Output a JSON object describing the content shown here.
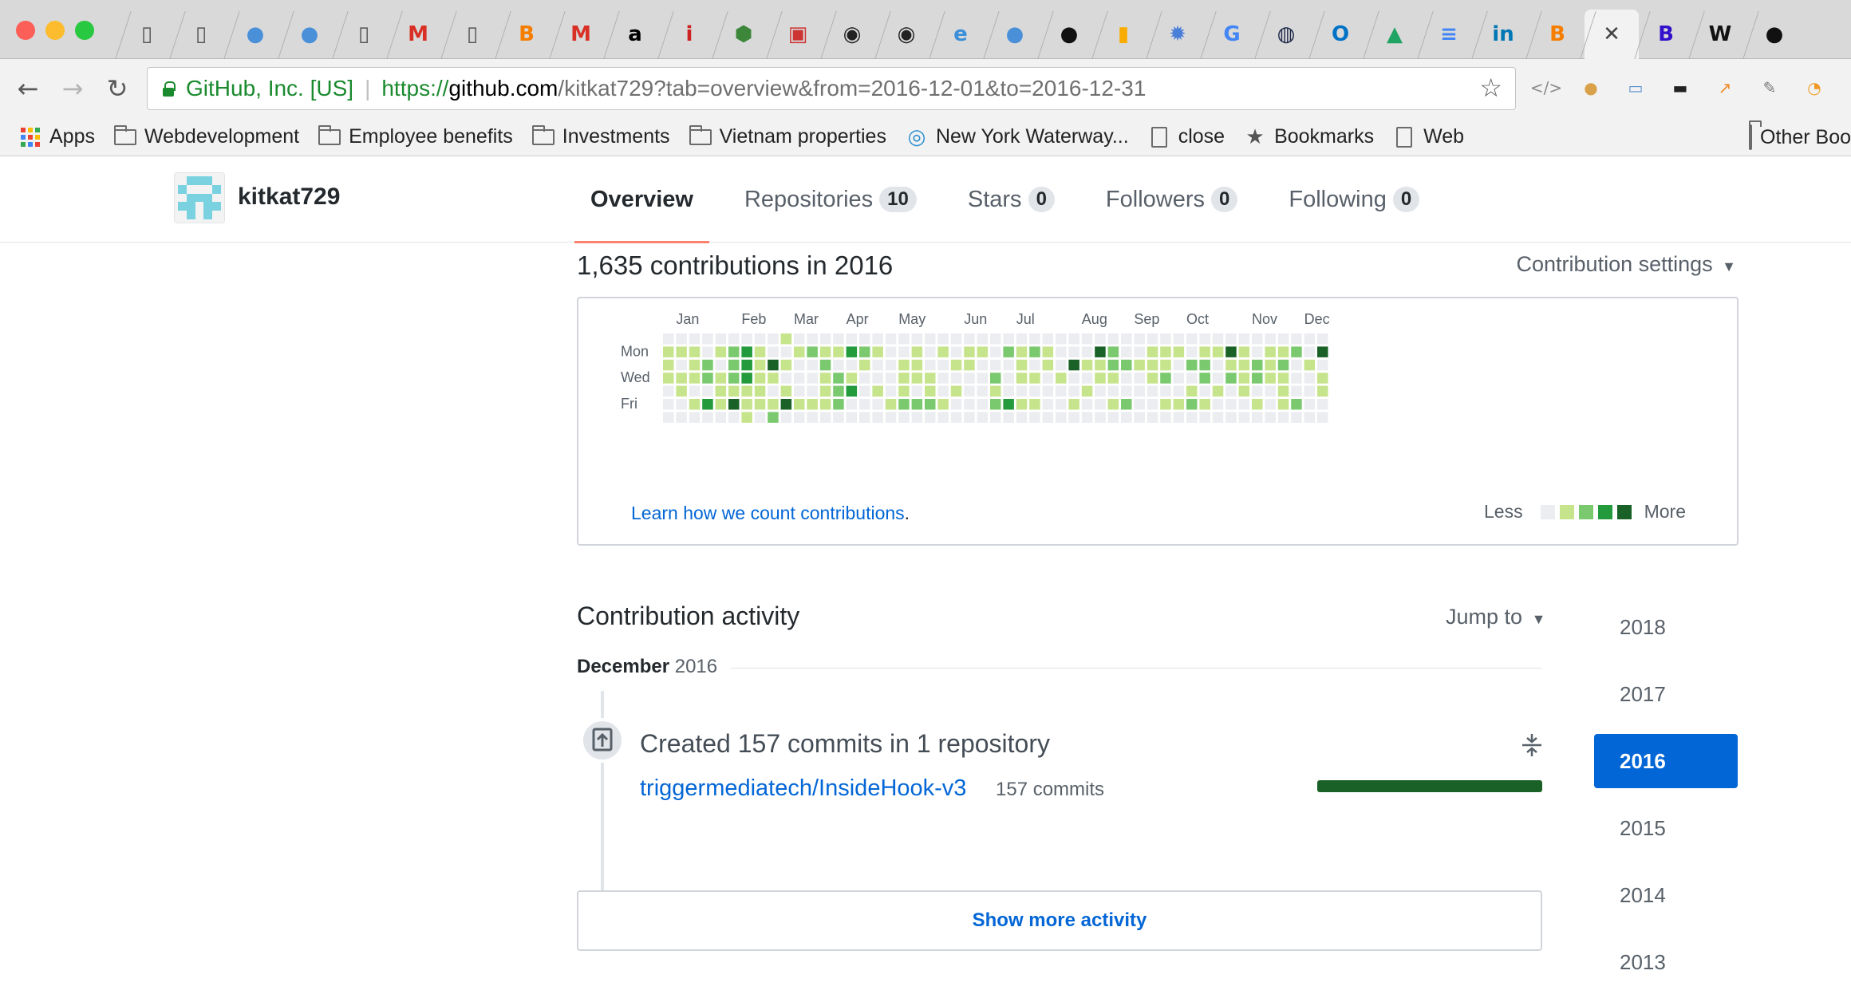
{
  "browser": {
    "tabs": [
      {
        "icon": "page-icon",
        "glyph": "▯",
        "color": "#555555"
      },
      {
        "icon": "page-icon",
        "glyph": "▯",
        "color": "#555555"
      },
      {
        "icon": "head-icon",
        "glyph": "●",
        "color": "#4a90d9"
      },
      {
        "icon": "head-icon",
        "glyph": "●",
        "color": "#4a90d9"
      },
      {
        "icon": "page-icon",
        "glyph": "▯",
        "color": "#555555"
      },
      {
        "icon": "gmail-icon",
        "glyph": "M",
        "color": "#d93025"
      },
      {
        "icon": "page-icon",
        "glyph": "▯",
        "color": "#555555"
      },
      {
        "icon": "blogger-icon",
        "glyph": "B",
        "color": "#f57d00"
      },
      {
        "icon": "gmail-icon",
        "glyph": "M",
        "color": "#d93025"
      },
      {
        "icon": "amazon-icon",
        "glyph": "a",
        "color": "#000000"
      },
      {
        "icon": "italic-i-icon",
        "glyph": "i",
        "color": "#cc2222"
      },
      {
        "icon": "node-icon",
        "glyph": "⬢",
        "color": "#3c873a"
      },
      {
        "icon": "briefcase-icon",
        "glyph": "▣",
        "color": "#cc3333"
      },
      {
        "icon": "seal-icon",
        "glyph": "◉",
        "color": "#222222"
      },
      {
        "icon": "seal-icon",
        "glyph": "◉",
        "color": "#222222"
      },
      {
        "icon": "ie-icon",
        "glyph": "e",
        "color": "#3a8fd9"
      },
      {
        "icon": "head-icon",
        "glyph": "●",
        "color": "#4a90d9"
      },
      {
        "icon": "github-icon",
        "glyph": "●",
        "color": "#111111"
      },
      {
        "icon": "analytics-icon",
        "glyph": "▮",
        "color": "#f9ab00"
      },
      {
        "icon": "gear-bug-icon",
        "glyph": "✹",
        "color": "#4a7fd9"
      },
      {
        "icon": "google-icon",
        "glyph": "G",
        "color": "#4285f4"
      },
      {
        "icon": "lightbulb-icon",
        "glyph": "◍",
        "color": "#1e2a4a"
      },
      {
        "icon": "outlook-icon",
        "glyph": "O",
        "color": "#0072c6"
      },
      {
        "icon": "drive-icon",
        "glyph": "▲",
        "color": "#1fa463"
      },
      {
        "icon": "docs-icon",
        "glyph": "≡",
        "color": "#4285f4"
      },
      {
        "icon": "linkedin-icon",
        "glyph": "in",
        "color": "#0077b5"
      },
      {
        "icon": "blogger-icon",
        "glyph": "B",
        "color": "#f57d00"
      },
      {
        "icon": "close-icon",
        "glyph": "✕",
        "color": "#444444",
        "active": true
      },
      {
        "icon": "bootstrap-icon",
        "glyph": "B",
        "color": "#3311cc"
      },
      {
        "icon": "wikipedia-icon",
        "glyph": "W",
        "color": "#111111"
      },
      {
        "icon": "github-icon",
        "glyph": "●",
        "color": "#111111"
      }
    ],
    "address": {
      "org": "GitHub, Inc. [US]",
      "scheme": "https://",
      "host": "github.com",
      "path": "/kitkat729?tab=overview&from=2016-12-01&to=2016-12-31"
    },
    "extensions": [
      {
        "icon": "code-icon",
        "glyph": "</>",
        "color": "#8a8a8a"
      },
      {
        "icon": "cookie-icon",
        "glyph": "●",
        "color": "#d9a24a"
      },
      {
        "icon": "window-icon",
        "glyph": "▭",
        "color": "#5b8fd0"
      },
      {
        "icon": "terminal-icon",
        "glyph": "▬",
        "color": "#222222"
      },
      {
        "icon": "chart-icon",
        "glyph": "↗",
        "color": "#f08a24"
      },
      {
        "icon": "pencil-icon",
        "glyph": "✎",
        "color": "#777777"
      },
      {
        "icon": "rss-icon",
        "glyph": "◔",
        "color": "#f09a24"
      }
    ],
    "bookmarks": [
      {
        "icon": "apps-icon",
        "label": "Apps"
      },
      {
        "icon": "folder-icon",
        "label": "Webdevelopment"
      },
      {
        "icon": "folder-icon",
        "label": "Employee benefits"
      },
      {
        "icon": "folder-icon",
        "label": "Investments"
      },
      {
        "icon": "folder-icon",
        "label": "Vietnam properties"
      },
      {
        "icon": "waterway-icon",
        "label": "New York Waterway..."
      },
      {
        "icon": "page-icon",
        "label": "close"
      },
      {
        "icon": "star-icon",
        "label": "Bookmarks"
      },
      {
        "icon": "page-icon",
        "label": "Web"
      }
    ],
    "other_bookmarks": "Other Boo"
  },
  "profile": {
    "username": "kitkat729",
    "avatar_color": "#7ad2e0",
    "nav": [
      {
        "label": "Overview",
        "active": true
      },
      {
        "label": "Repositories",
        "count": "10"
      },
      {
        "label": "Stars",
        "count": "0"
      },
      {
        "label": "Followers",
        "count": "0"
      },
      {
        "label": "Following",
        "count": "0"
      }
    ]
  },
  "contributions": {
    "title": "1,635 contributions in 2016",
    "settings_label": "Contribution settings",
    "months": [
      "Jan",
      "Feb",
      "Mar",
      "Apr",
      "May",
      "Jun",
      "Jul",
      "Aug",
      "Sep",
      "Oct",
      "Nov",
      "Dec"
    ],
    "weekday_labels": [
      "",
      "Mon",
      "",
      "Wed",
      "",
      "Fri",
      ""
    ],
    "learn_link": "Learn how we count contributions",
    "legend_less": "Less",
    "legend_more": "More",
    "levels_colors": [
      "#ebedf0",
      "#c6e48b",
      "#7bc96f",
      "#239a3b",
      "#196127"
    ],
    "weeks": [
      [
        0,
        1,
        1,
        1,
        0,
        0,
        0
      ],
      [
        0,
        1,
        0,
        1,
        1,
        0,
        0
      ],
      [
        0,
        1,
        1,
        1,
        0,
        1,
        0
      ],
      [
        0,
        0,
        2,
        2,
        0,
        3,
        0
      ],
      [
        0,
        1,
        0,
        1,
        1,
        1,
        0
      ],
      [
        0,
        2,
        2,
        2,
        1,
        4,
        0
      ],
      [
        0,
        3,
        3,
        3,
        1,
        1,
        1
      ],
      [
        0,
        1,
        1,
        1,
        1,
        1,
        0
      ],
      [
        0,
        0,
        4,
        1,
        0,
        1,
        2
      ],
      [
        1,
        0,
        1,
        0,
        1,
        4,
        0
      ],
      [
        0,
        1,
        0,
        0,
        0,
        1,
        0
      ],
      [
        0,
        2,
        0,
        0,
        0,
        1,
        0
      ],
      [
        0,
        1,
        2,
        1,
        1,
        1,
        0
      ],
      [
        0,
        1,
        0,
        2,
        2,
        2,
        0
      ],
      [
        0,
        3,
        0,
        1,
        3,
        0,
        0
      ],
      [
        0,
        2,
        1,
        0,
        0,
        0,
        0
      ],
      [
        0,
        1,
        0,
        0,
        1,
        0,
        0
      ],
      [
        0,
        0,
        0,
        0,
        0,
        1,
        0
      ],
      [
        0,
        0,
        1,
        1,
        1,
        2,
        0
      ],
      [
        0,
        1,
        1,
        1,
        0,
        2,
        0
      ],
      [
        0,
        0,
        0,
        1,
        1,
        2,
        0
      ],
      [
        0,
        1,
        0,
        0,
        0,
        1,
        0
      ],
      [
        0,
        0,
        1,
        0,
        1,
        0,
        0
      ],
      [
        0,
        1,
        1,
        0,
        0,
        0,
        0
      ],
      [
        0,
        1,
        0,
        0,
        0,
        0,
        0
      ],
      [
        0,
        0,
        0,
        2,
        1,
        2,
        0
      ],
      [
        0,
        2,
        0,
        0,
        0,
        3,
        0
      ],
      [
        0,
        1,
        1,
        1,
        0,
        1,
        0
      ],
      [
        0,
        2,
        0,
        1,
        0,
        1,
        0
      ],
      [
        0,
        1,
        1,
        0,
        0,
        0,
        0
      ],
      [
        0,
        0,
        0,
        1,
        0,
        0,
        0
      ],
      [
        0,
        0,
        4,
        0,
        0,
        1,
        0
      ],
      [
        0,
        0,
        1,
        0,
        1,
        0,
        0
      ],
      [
        0,
        4,
        1,
        1,
        0,
        0,
        0
      ],
      [
        0,
        2,
        2,
        1,
        0,
        1,
        0
      ],
      [
        0,
        0,
        2,
        0,
        0,
        2,
        0
      ],
      [
        0,
        0,
        1,
        0,
        0,
        0,
        0
      ],
      [
        0,
        1,
        1,
        1,
        0,
        0,
        0
      ],
      [
        0,
        1,
        1,
        2,
        0,
        1,
        0
      ],
      [
        0,
        1,
        0,
        0,
        0,
        1,
        0
      ],
      [
        0,
        0,
        2,
        0,
        1,
        2,
        0
      ],
      [
        0,
        1,
        2,
        2,
        0,
        1,
        0
      ],
      [
        0,
        1,
        0,
        0,
        1,
        0,
        0
      ],
      [
        0,
        4,
        1,
        2,
        0,
        0,
        0
      ],
      [
        0,
        1,
        1,
        1,
        1,
        0,
        0
      ],
      [
        0,
        0,
        2,
        2,
        0,
        1,
        0
      ],
      [
        0,
        1,
        1,
        1,
        0,
        0,
        0
      ],
      [
        0,
        1,
        2,
        1,
        1,
        1,
        0
      ],
      [
        0,
        2,
        0,
        0,
        0,
        2,
        0
      ],
      [
        0,
        0,
        1,
        0,
        0,
        0,
        0
      ],
      [
        0,
        4,
        0,
        1,
        1,
        0,
        0
      ]
    ]
  },
  "activity": {
    "title": "Contribution activity",
    "jump_to": "Jump to",
    "month": "December",
    "year": "2016",
    "commit_heading": "Created 157 commits in 1 repository",
    "repo_name": "triggermediatech/InsideHook-v3",
    "repo_commits": "157 commits",
    "repo_progress": 1.0,
    "show_more": "Show more activity"
  },
  "years": [
    "2018",
    "2017",
    "2016",
    "2015",
    "2014",
    "2013"
  ],
  "selected_year": "2016"
}
